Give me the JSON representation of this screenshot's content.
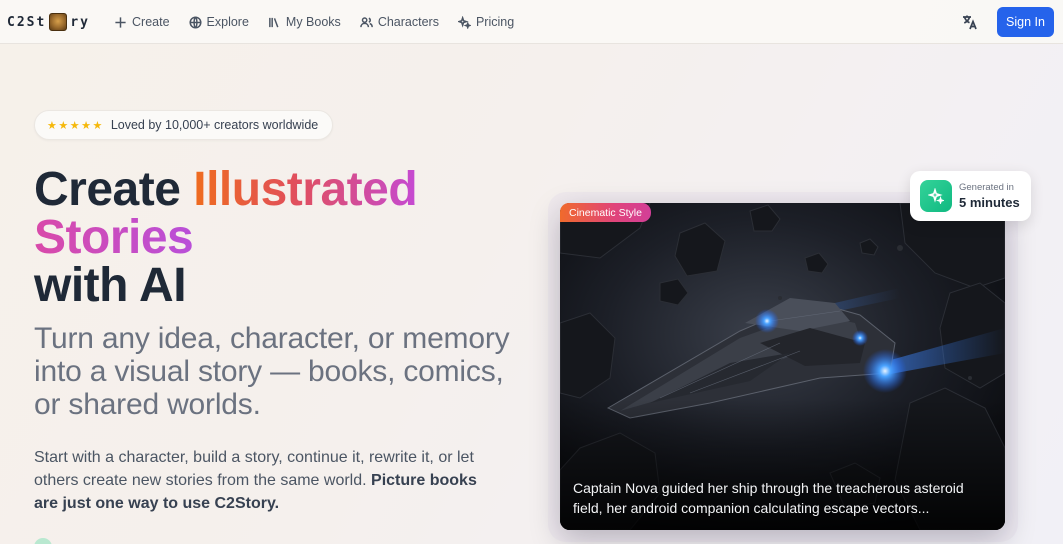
{
  "nav": {
    "logo_text_left": "C2St",
    "logo_text_right": "ry",
    "links": [
      {
        "label": "Create",
        "icon": "plus-icon"
      },
      {
        "label": "Explore",
        "icon": "globe-icon"
      },
      {
        "label": "My Books",
        "icon": "library-icon"
      },
      {
        "label": "Characters",
        "icon": "users-icon"
      },
      {
        "label": "Pricing",
        "icon": "sparkles-icon"
      }
    ],
    "translate_icon": "translate-icon",
    "signin_label": "Sign In",
    "signin_color": "#2563eb"
  },
  "hero": {
    "badge_stars": "★★★★★",
    "badge_text": "Loved by 10,000+ creators worldwide",
    "headline_part1": "Create ",
    "headline_accent1": "Illustrated",
    "headline_accent2": "Stories",
    "headline_part3": "with AI",
    "subhead": "Turn any idea, character, or memory into a visual story — books, comics, or shared worlds.",
    "body_plain": "Start with a character, build a story, continue it, rewrite it, or let others create new stories from the same world. ",
    "body_bold": "Picture books are just one way to use C2Story."
  },
  "preview": {
    "style_tag": "Cinematic Style",
    "caption": "Captain Nova guided her ship through the treacherous asteroid field, her android companion calculating escape vectors...",
    "generated_label": "Generated in",
    "generated_value": "5 minutes",
    "accent_green": "#10b981"
  }
}
